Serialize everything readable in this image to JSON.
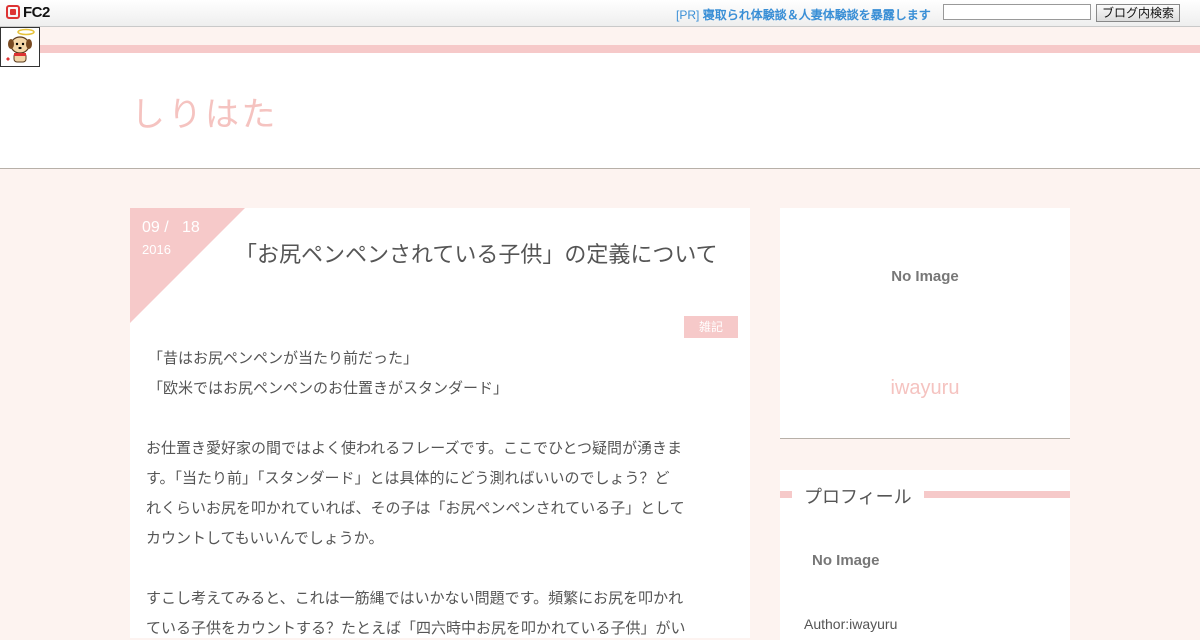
{
  "fc2bar": {
    "logo": "FC2",
    "pr_prefix": "[PR]",
    "pr_text": "寝取られ体験談＆人妻体験談を暴露します",
    "search_value": "",
    "search_button": "ブログ内検索"
  },
  "header": {
    "site_title": "しりはた"
  },
  "article": {
    "month_day": "09 /   18",
    "year": "2016",
    "title": "「お尻ペンペンされている子供」の定義について",
    "category": "雑記",
    "lines": [
      "「昔はお尻ペンペンが当たり前だった」",
      "「欧米ではお尻ペンペンのお仕置きがスタンダード」",
      "",
      "お仕置き愛好家の間ではよく使われるフレーズです。ここでひとつ疑問が湧きま",
      "す。「当たり前」「スタンダード」とは具体的にどう測ればいいのでしょう？ど",
      "れくらいお尻を叩かれていれば、その子は「お尻ペンペンされている子」として",
      "カウントしてもいいんでしょうか。",
      "",
      "すこし考えてみると、これは一筋縄ではいかない問題です。頻繁にお尻を叩かれ",
      "ている子供をカウントする？たとえば「四六時中お尻を叩かれている子供」がい"
    ]
  },
  "sidebar": {
    "image_placeholder": "No Image",
    "author_name": "iwayuru",
    "profile_title": "プロフィール",
    "profile_image_placeholder": "No Image",
    "profile_author": "Author:iwayuru"
  },
  "colors": {
    "accent_pink": "#f6c9c9",
    "title_pink": "#f5c3c0",
    "background": "#fdf3f0",
    "link_blue": "#3a8fd6"
  }
}
